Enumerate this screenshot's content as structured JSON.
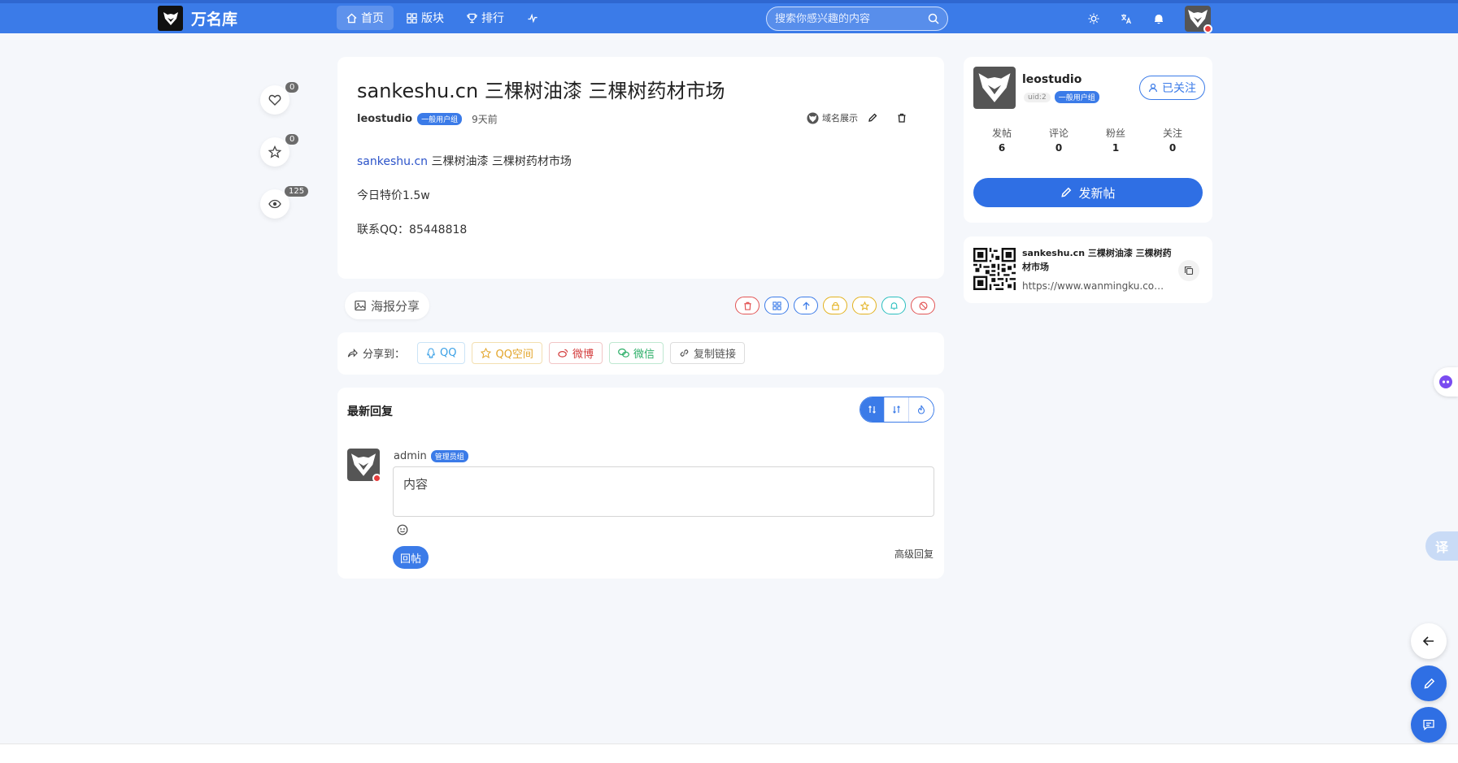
{
  "topbar": {
    "site_name": "万名库",
    "nav": [
      {
        "label": "首页",
        "icon": "home-icon",
        "active": true
      },
      {
        "label": "版块",
        "icon": "grid-icon",
        "active": false
      },
      {
        "label": "排行",
        "icon": "trophy-icon",
        "active": false
      }
    ],
    "search_placeholder": "搜索你感兴趣的内容",
    "accent_color": "#3b7be8"
  },
  "side_stats": {
    "likes": "0",
    "favorites": "0",
    "views": "125"
  },
  "post": {
    "title": "sankeshu.cn 三棵树油漆 三棵树药材市场",
    "author": "leostudio",
    "author_group": "一般用户组",
    "time": "9天前",
    "forum": "域名展示",
    "body_site": "sankeshu.cn",
    "body_rest": " 三棵树油漆 三棵树药材市场",
    "price_line": "今日特价1.5w",
    "contact_line": "联系QQ：85448818"
  },
  "poster_share_label": "海报分享",
  "share": {
    "label": "分享到：",
    "buttons": [
      {
        "label": "QQ",
        "icon": "qq-icon",
        "color": "#3aa0e6"
      },
      {
        "label": "QQ空间",
        "icon": "qzone-icon",
        "color": "#e3a52a"
      },
      {
        "label": "微博",
        "icon": "weibo-icon",
        "color": "#d33a3a"
      },
      {
        "label": "微信",
        "icon": "wechat-icon",
        "color": "#2bae67"
      },
      {
        "label": "复制链接",
        "icon": "link-icon",
        "color": "#555555"
      }
    ]
  },
  "replies": {
    "title": "最新回复",
    "reply_user": "admin",
    "reply_user_group": "管理员组",
    "reply_placeholder": "内容",
    "submit_label": "回帖",
    "advanced_label": "高级回复"
  },
  "profile": {
    "name": "leostudio",
    "uid": "uid:2",
    "group": "一般用户组",
    "follow_label": "已关注",
    "stats": [
      {
        "label": "发帖",
        "value": "6"
      },
      {
        "label": "评论",
        "value": "0"
      },
      {
        "label": "粉丝",
        "value": "1"
      },
      {
        "label": "关注",
        "value": "0"
      }
    ],
    "new_post_label": "发新帖"
  },
  "share_card": {
    "title": "sankeshu.cn 三棵树油漆 三棵树药材市场",
    "url": "https://www.wanmingku.com/..."
  },
  "translate_label": "译"
}
